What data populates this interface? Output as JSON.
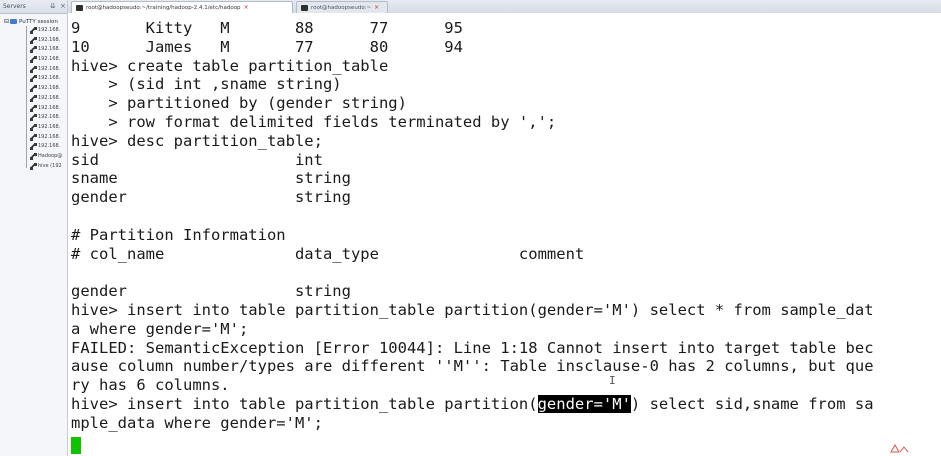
{
  "sidebar": {
    "title": "Servers",
    "root_label": "PuTTY session",
    "items": [
      {
        "label": "192.168."
      },
      {
        "label": "192.168."
      },
      {
        "label": "192.168."
      },
      {
        "label": "192.168."
      },
      {
        "label": "192.168."
      },
      {
        "label": "192.168."
      },
      {
        "label": "192.168."
      },
      {
        "label": "192.168."
      },
      {
        "label": "192.168."
      },
      {
        "label": "192.168."
      },
      {
        "label": "192.168."
      },
      {
        "label": "192.168."
      },
      {
        "label": "192.168."
      },
      {
        "label": "Hadoop@"
      },
      {
        "label": "hive (192"
      }
    ]
  },
  "tabs": [
    {
      "label": "root@hadoopseudo:~/training/hadoop-2.4.1/etc/hadoop",
      "active": true
    },
    {
      "label": "root@hadoopseudo:~",
      "active": false
    }
  ],
  "terminal": {
    "lines": [
      {
        "pre": "9       Kitty   M       88      77      95"
      },
      {
        "pre": "10      James   M       77      80      94"
      },
      {
        "pre": "hive> create table partition_table"
      },
      {
        "pre": "    > (sid int ,sname string)"
      },
      {
        "pre": "    > partitioned by (gender string)"
      },
      {
        "pre": "    > row format delimited fields terminated by ',';"
      },
      {
        "pre": "hive> desc partition_table;"
      },
      {
        "pre": "sid                     int"
      },
      {
        "pre": "sname                   string"
      },
      {
        "pre": "gender                  string"
      },
      {
        "pre": ""
      },
      {
        "pre": "# Partition Information"
      },
      {
        "pre": "# col_name              data_type               comment"
      },
      {
        "pre": ""
      },
      {
        "pre": "gender                  string"
      },
      {
        "pre": "hive> insert into table partition_table partition(gender='M') select * from sample_dat"
      },
      {
        "pre": "a where gender='M';"
      },
      {
        "pre": "FAILED: SemanticException [Error 10044]: Line 1:18 Cannot insert into target table bec"
      },
      {
        "pre": "ause column number/types are different ''M'': Table insclause-0 has 2 columns, but que"
      },
      {
        "pre": "ry has 6 columns."
      },
      {
        "pre": "hive> insert into table partition_table partition(",
        "hl": "gender='M'",
        "post": ") select sid,sname from sa"
      },
      {
        "pre": "mple_data where gender='M';"
      }
    ]
  },
  "colors": {
    "cursor": "#11c200",
    "selection_bg": "#000000",
    "selection_fg": "#ffffff",
    "terminal_bg": "#ffffff",
    "terminal_fg": "#1a1a1a"
  }
}
